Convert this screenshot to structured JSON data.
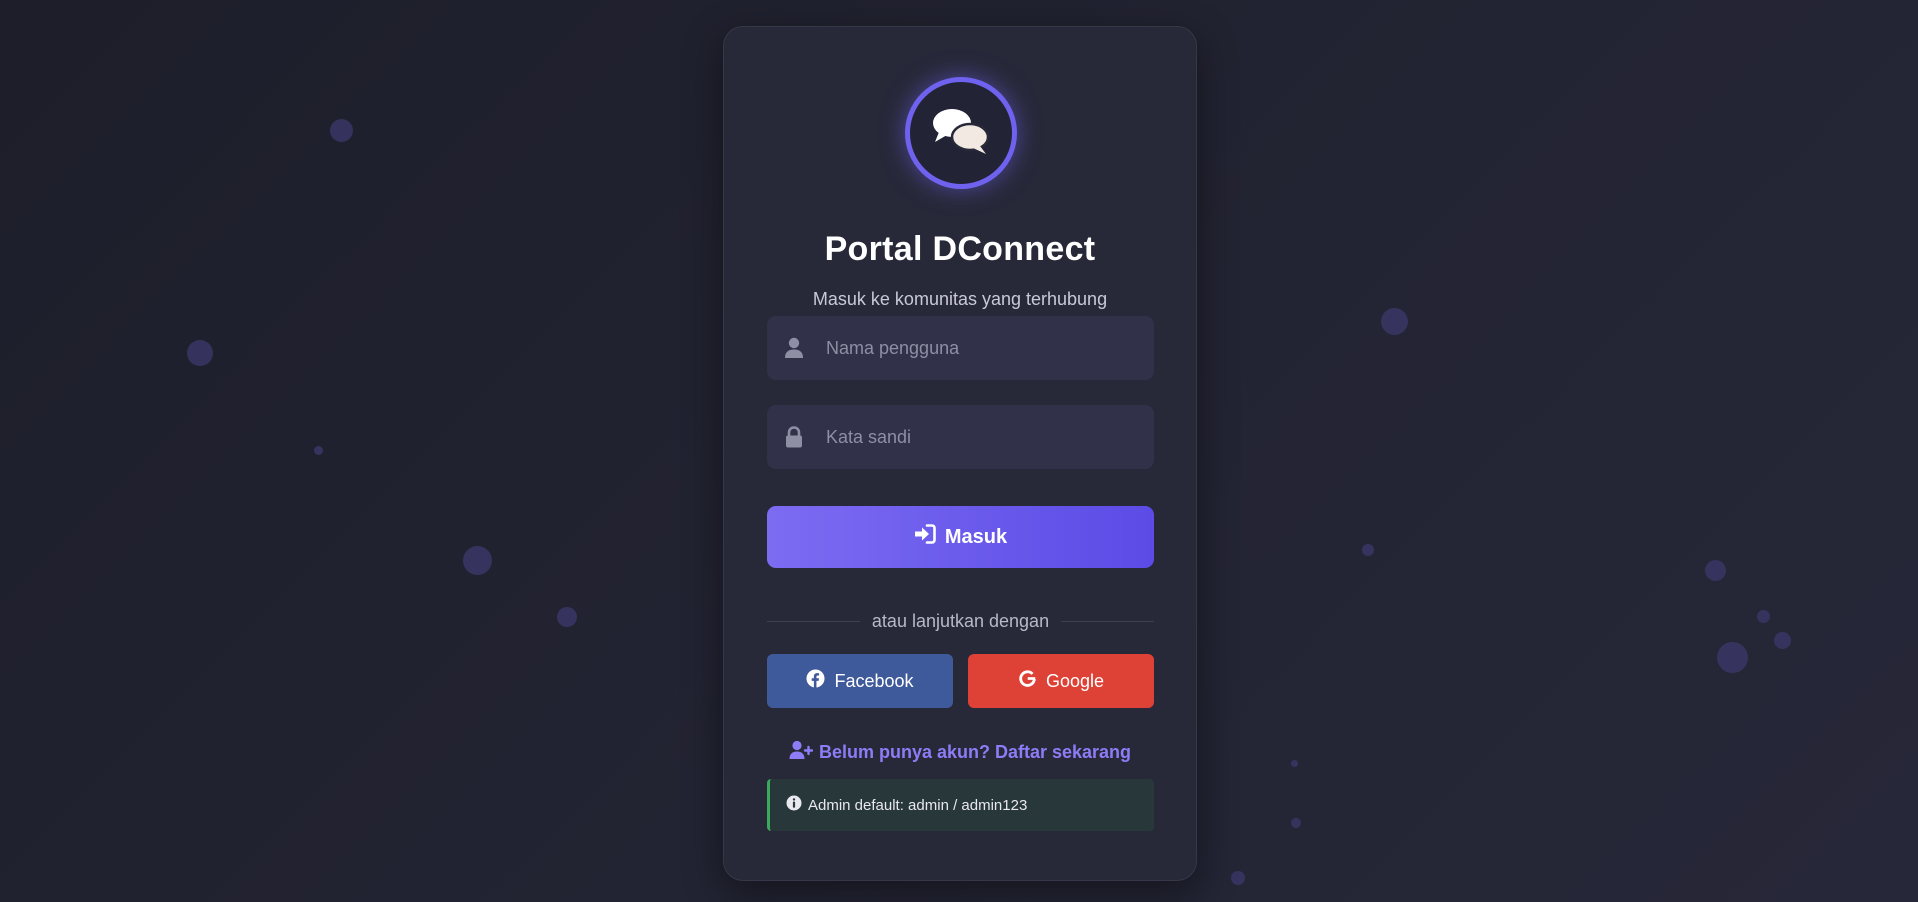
{
  "app": {
    "title": "Portal DConnect",
    "subtitle": "Masuk ke komunitas yang terhubung"
  },
  "form": {
    "username": {
      "placeholder": "Nama pengguna",
      "value": "",
      "icon": "user-icon"
    },
    "password": {
      "placeholder": "Kata sandi",
      "value": "",
      "icon": "lock-icon"
    },
    "submit_label": "Masuk",
    "submit_icon": "sign-in-icon"
  },
  "divider_text": "atau lanjutkan dengan",
  "social": {
    "facebook_label": "Facebook",
    "google_label": "Google"
  },
  "register_link": "Belum punya akun? Daftar sekarang",
  "info_text": "Admin default: admin / admin123",
  "colors": {
    "accent": "#7c6cf2",
    "facebook": "#3f5a9b",
    "google": "#de4136",
    "info_border": "#3aa95c",
    "link": "#8e7cf6"
  }
}
